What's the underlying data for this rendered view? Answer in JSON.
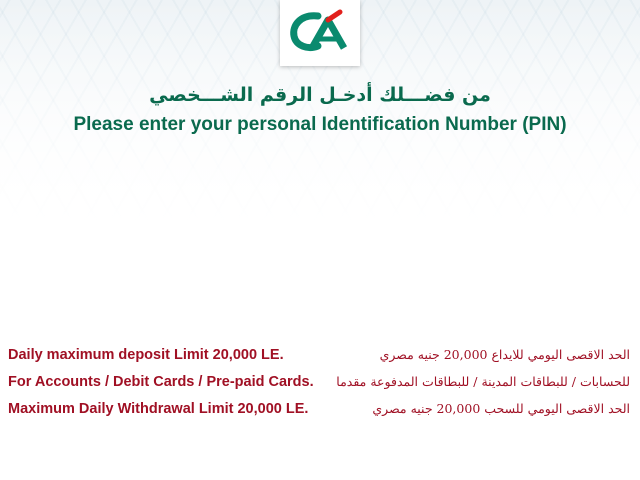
{
  "brand": {
    "logo_text": "CA",
    "colors": {
      "green": "#0a8a6e",
      "red": "#e2201c",
      "text_green": "#0a6a4e",
      "info_red": "#a01024"
    }
  },
  "prompt": {
    "arabic": "من فضـــلك أدخـل الرقم الشـــخصي",
    "english": "Please enter your personal Identification Number (PIN)"
  },
  "info": {
    "english": [
      "Daily maximum deposit Limit 20,000 LE.",
      "For Accounts / Debit Cards / Pre-paid Cards.",
      "Maximum Daily Withdrawal Limit 20,000 LE."
    ],
    "arabic": [
      "الحد الاقصى اليومي للايداع 20,000 جنيه مصري",
      "للحسابات / للبطاقات المدينة / للبطاقات المدفوعة مقدما",
      "الحد الاقصى اليومي للسحب 20,000 جنيه مصري"
    ]
  }
}
